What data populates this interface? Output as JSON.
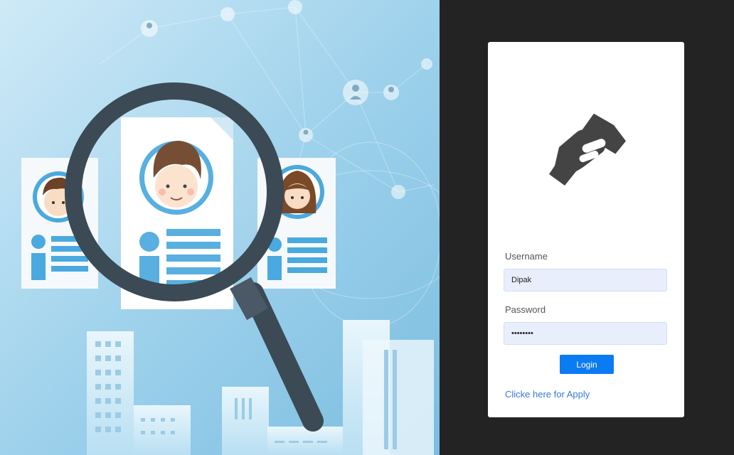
{
  "hero": {
    "illustration": "recruitment-search-illustration"
  },
  "login": {
    "logo_icon": "handshake-icon",
    "username_label": "Username",
    "username_value": "Dipak",
    "password_label": "Password",
    "password_value": "Dipak123",
    "login_button": "Login",
    "apply_link": "Clicke here for Apply"
  },
  "colors": {
    "accent": "#0b7bf2",
    "link": "#3a78d6",
    "panel": "#232323",
    "input_bg": "#e8eefc"
  }
}
